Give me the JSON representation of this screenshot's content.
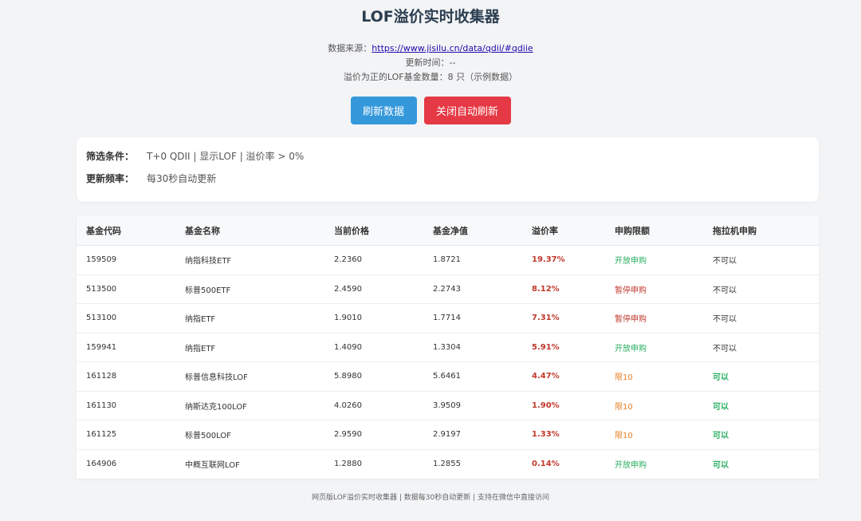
{
  "header": {
    "title": "LOF溢价实时收集器",
    "source_label": "数据来源：",
    "source_url": "https://www.jisilu.cn/data/qdii/#qdiie",
    "update_time": "更新时间：--",
    "count_text": "溢价为正的LOF基金数量：8 只（示例数据）"
  },
  "buttons": {
    "refresh": "刷新数据",
    "close_auto": "关闭自动刷新"
  },
  "filters": {
    "condition_label": "筛选条件：",
    "condition_value": "T+0 QDII | 显示LOF | 溢价率 > 0%",
    "freq_label": "更新频率：",
    "freq_value": "每30秒自动更新"
  },
  "table": {
    "headers": [
      "基金代码",
      "基金名称",
      "当前价格",
      "基金净值",
      "溢价率",
      "申购限额",
      "拖拉机申购"
    ],
    "rows": [
      {
        "code": "159509",
        "name": "纳指科技ETF",
        "price": "2.2360",
        "nav": "1.8721",
        "premium": "19.37%",
        "limit": "开放申购",
        "limit_type": "open",
        "tractor": "不可以",
        "tractor_type": "no"
      },
      {
        "code": "513500",
        "name": "标普500ETF",
        "price": "2.4590",
        "nav": "2.2743",
        "premium": "8.12%",
        "limit": "暂停申购",
        "limit_type": "pause",
        "tractor": "不可以",
        "tractor_type": "no"
      },
      {
        "code": "513100",
        "name": "纳指ETF",
        "price": "1.9010",
        "nav": "1.7714",
        "premium": "7.31%",
        "limit": "暂停申购",
        "limit_type": "pause",
        "tractor": "不可以",
        "tractor_type": "no"
      },
      {
        "code": "159941",
        "name": "纳指ETF",
        "price": "1.4090",
        "nav": "1.3304",
        "premium": "5.91%",
        "limit": "开放申购",
        "limit_type": "open",
        "tractor": "不可以",
        "tractor_type": "no"
      },
      {
        "code": "161128",
        "name": "标普信息科技LOF",
        "price": "5.8980",
        "nav": "5.6461",
        "premium": "4.47%",
        "limit": "限10",
        "limit_type": "limit",
        "tractor": "可以",
        "tractor_type": "yes"
      },
      {
        "code": "161130",
        "name": "纳斯达克100LOF",
        "price": "4.0260",
        "nav": "3.9509",
        "premium": "1.90%",
        "limit": "限10",
        "limit_type": "limit",
        "tractor": "可以",
        "tractor_type": "yes"
      },
      {
        "code": "161125",
        "name": "标普500LOF",
        "price": "2.9590",
        "nav": "2.9197",
        "premium": "1.33%",
        "limit": "限10",
        "limit_type": "limit",
        "tractor": "可以",
        "tractor_type": "yes"
      },
      {
        "code": "164906",
        "name": "中概互联网LOF",
        "price": "1.2880",
        "nav": "1.2855",
        "premium": "0.14%",
        "limit": "开放申购",
        "limit_type": "open",
        "tractor": "可以",
        "tractor_type": "yes"
      }
    ]
  },
  "footer": "网页版LOF溢价实时收集器 | 数据每30秒自动更新 | 支持在微信中直接访问",
  "colors": {
    "refresh_button": "#3498db",
    "close_button": "#e53945",
    "premium": "#c0392b",
    "open": "#27ae60",
    "limit": "#e67e22"
  }
}
